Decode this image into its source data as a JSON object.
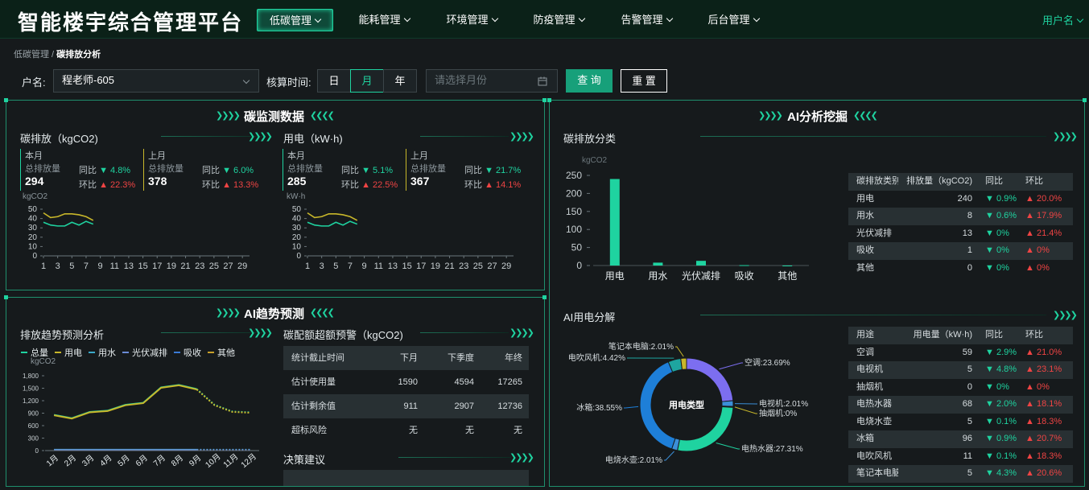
{
  "header": {
    "title": "智能楼宇综合管理平台",
    "nav": [
      {
        "label": "低碳管理",
        "active": true
      },
      {
        "label": "能耗管理",
        "active": false
      },
      {
        "label": "环境管理",
        "active": false
      },
      {
        "label": "防疫管理",
        "active": false
      },
      {
        "label": "告警管理",
        "active": false
      },
      {
        "label": "后台管理",
        "active": false
      }
    ],
    "user": "用户名"
  },
  "breadcrumb": {
    "parent": "低碳管理",
    "sep": " / ",
    "current": "碳排放分析"
  },
  "filters": {
    "household_label": "户名:",
    "household_value": "程老师-605",
    "period_label": "核算时间:",
    "period_options": [
      "日",
      "月",
      "年"
    ],
    "period_selected": "月",
    "month_placeholder": "请选择月份",
    "query_label": "查 询",
    "reset_label": "重 置"
  },
  "carbon_monitor": {
    "title": "碳监测数据",
    "emission": {
      "subtitle": "碳排放（kgCO2)",
      "this_month": {
        "label": "本月",
        "total_label": "总排放量",
        "value": "294",
        "yoy_label": "同比",
        "yoy": "4.8%",
        "mom_label": "环比",
        "mom": "22.3%"
      },
      "last_month": {
        "label": "上月",
        "total_label": "总排放量",
        "value": "378",
        "yoy_label": "同比",
        "yoy": "6.0%",
        "mom_label": "环比",
        "mom": "13.3%"
      },
      "unit": "kgCO2"
    },
    "electricity": {
      "subtitle": "用电（kW·h)",
      "this_month": {
        "label": "本月",
        "total_label": "总排放量",
        "value": "285",
        "yoy_label": "同比",
        "yoy": "5.1%",
        "mom_label": "环比",
        "mom": "22.5%"
      },
      "last_month": {
        "label": "上月",
        "total_label": "总排放量",
        "value": "367",
        "yoy_label": "同比",
        "yoy": "21.7%",
        "mom_label": "环比",
        "mom": "14.1%"
      },
      "unit": "kW·h"
    }
  },
  "chart_data": [
    {
      "type": "line",
      "id": "emission-mini",
      "ylabel": "kgCO2",
      "ylim": [
        0,
        50
      ],
      "yticks": [
        0,
        10,
        20,
        30,
        40,
        50
      ],
      "x": [
        1,
        2,
        3,
        4,
        5,
        6,
        7,
        8
      ],
      "xticks": [
        1,
        3,
        5,
        7,
        9,
        11,
        13,
        15,
        17,
        19,
        21,
        23,
        25,
        27,
        29
      ],
      "xlim": [
        1,
        30
      ],
      "series": [
        {
          "color": "#c8b72a",
          "values": [
            46,
            41,
            42,
            45,
            45,
            44,
            42,
            38
          ]
        },
        {
          "color": "#1fd3a0",
          "values": [
            36,
            33,
            32,
            32,
            36,
            33,
            37,
            34
          ]
        }
      ]
    },
    {
      "type": "line",
      "id": "electricity-mini",
      "ylabel": "kW·h",
      "ylim": [
        0,
        50
      ],
      "yticks": [
        0,
        10,
        20,
        30,
        40,
        50
      ],
      "x": [
        1,
        2,
        3,
        4,
        5,
        6,
        7,
        8
      ],
      "xticks": [
        1,
        3,
        5,
        7,
        9,
        11,
        13,
        15,
        17,
        19,
        21,
        23,
        25,
        27,
        29
      ],
      "xlim": [
        1,
        30
      ],
      "series": [
        {
          "color": "#c8b72a",
          "values": [
            46,
            41,
            42,
            45,
            45,
            44,
            42,
            38
          ]
        },
        {
          "color": "#1fd3a0",
          "values": [
            36,
            33,
            32,
            32,
            36,
            33,
            37,
            34
          ]
        }
      ]
    },
    {
      "type": "bar",
      "id": "emission-category",
      "ylabel": "kgCO2",
      "ylim": [
        0,
        250
      ],
      "yticks": [
        0,
        50,
        100,
        150,
        200,
        250
      ],
      "categories": [
        "用电",
        "用水",
        "光伏减排",
        "吸收",
        "其他"
      ],
      "values": [
        240,
        8,
        13,
        1,
        0
      ],
      "color": "#1fd3a0"
    },
    {
      "type": "line",
      "id": "trend-forecast",
      "ylabel": "kgCO2",
      "ylim": [
        0,
        1800
      ],
      "yticks": [
        0,
        300,
        600,
        900,
        1200,
        1500,
        1800
      ],
      "ytick_labels": [
        "0",
        "300",
        "600",
        "900",
        "1,200",
        "1,500",
        "1,800"
      ],
      "categories": [
        "1月",
        "2月",
        "3月",
        "4月",
        "5月",
        "6月",
        "7月",
        "8月",
        "9月",
        "10月",
        "11月",
        "12月"
      ],
      "legend": [
        "总量",
        "用电",
        "用水",
        "光伏减排",
        "吸收",
        "其他"
      ],
      "legend_colors": [
        "#1fd3a0",
        "#c8b72a",
        "#3ba9c9",
        "#6b8bd6",
        "#3a7bd5",
        "#c8a02a"
      ],
      "series": [
        {
          "name": "总量",
          "values": [
            860,
            780,
            930,
            960,
            1100,
            1150,
            1520,
            1580,
            1480,
            1100,
            940,
            920
          ]
        },
        {
          "name": "用电",
          "values": [
            850,
            770,
            920,
            950,
            1090,
            1140,
            1510,
            1570,
            1470,
            1090,
            930,
            910
          ]
        },
        {
          "name": "用水",
          "values": [
            30,
            30,
            30,
            30,
            30,
            30,
            30,
            30,
            30,
            30,
            30,
            30
          ]
        },
        {
          "name": "光伏减排",
          "values": [
            20,
            20,
            20,
            20,
            20,
            20,
            20,
            20,
            20,
            20,
            20,
            20
          ]
        }
      ]
    },
    {
      "type": "pie",
      "id": "ai-electricity",
      "center_label": "用电类型",
      "slices": [
        {
          "label": "空调:23.69%",
          "value": 23.69,
          "color": "#7c6ef0"
        },
        {
          "label": "电视机:2.01%",
          "value": 2.01,
          "color": "#3b8fd8"
        },
        {
          "label": "抽烟机:0%",
          "value": 0.3,
          "color": "#c8b72a"
        },
        {
          "label": "电热水器:27.31%",
          "value": 27.31,
          "color": "#1fd3a0"
        },
        {
          "label": "电烧水壶:2.01%",
          "value": 2.01,
          "color": "#3b8fd8"
        },
        {
          "label": "冰箱:38.55%",
          "value": 38.55,
          "color": "#1e7fd8"
        },
        {
          "label": "电吹风机:4.42%",
          "value": 4.42,
          "color": "#1ea5a0"
        },
        {
          "label": "笔记本电脑:2.01%",
          "value": 2.01,
          "color": "#c8b72a"
        }
      ]
    }
  ],
  "ai_analysis": {
    "title": "AI分析挖掘",
    "category_subtitle": "碳排放分类",
    "category_table": {
      "headers": [
        "碳排放类别",
        "排放量（kgCO2)",
        "同比",
        "环比"
      ],
      "rows": [
        {
          "name": "用电",
          "value": "240",
          "yoy": "0.9%",
          "mom": "20.0%"
        },
        {
          "name": "用水",
          "value": "8",
          "yoy": "0.6%",
          "mom": "17.9%"
        },
        {
          "name": "光伏减排",
          "value": "13",
          "yoy": "0%",
          "mom": "21.4%"
        },
        {
          "name": "吸收",
          "value": "1",
          "yoy": "0%",
          "mom": "0%"
        },
        {
          "name": "其他",
          "value": "0",
          "yoy": "0%",
          "mom": "0%"
        }
      ]
    },
    "electricity_subtitle": "AI用电分解",
    "electricity_table": {
      "headers": [
        "用途",
        "用电量（kW·h)",
        "同比",
        "环比"
      ],
      "rows": [
        {
          "name": "空调",
          "value": "59",
          "yoy": "2.9%",
          "mom": "21.0%"
        },
        {
          "name": "电视机",
          "value": "5",
          "yoy": "4.8%",
          "mom": "23.1%"
        },
        {
          "name": "抽烟机",
          "value": "0",
          "yoy": "0%",
          "mom": "0%"
        },
        {
          "name": "电热水器",
          "value": "68",
          "yoy": "2.0%",
          "mom": "18.1%"
        },
        {
          "name": "电烧水壶",
          "value": "5",
          "yoy": "0.1%",
          "mom": "18.3%"
        },
        {
          "name": "冰箱",
          "value": "96",
          "yoy": "0.9%",
          "mom": "20.7%"
        },
        {
          "name": "电吹风机",
          "value": "11",
          "yoy": "0.1%",
          "mom": "18.3%"
        },
        {
          "name": "笔记本电脑",
          "value": "5",
          "yoy": "4.3%",
          "mom": "20.6%"
        }
      ]
    }
  },
  "ai_trend": {
    "title": "AI趋势预测",
    "forecast_subtitle": "排放趋势预测分析",
    "quota_subtitle": "碳配额超额预警（kgCO2)",
    "quota_table": {
      "headers": [
        "统计截止时间",
        "下月",
        "下季度",
        "年终"
      ],
      "rows": [
        {
          "name": "估计使用量",
          "a": "1590",
          "b": "4594",
          "c": "17265"
        },
        {
          "name": "估计剩余值",
          "a": "911",
          "b": "2907",
          "c": "12736"
        },
        {
          "name": "超标风险",
          "a": "无",
          "b": "无",
          "c": "无"
        }
      ]
    },
    "advice_subtitle": "决策建议"
  },
  "colors": {
    "accent": "#1fd3a0",
    "warn": "#ef4444",
    "bg": "#161a1c"
  }
}
